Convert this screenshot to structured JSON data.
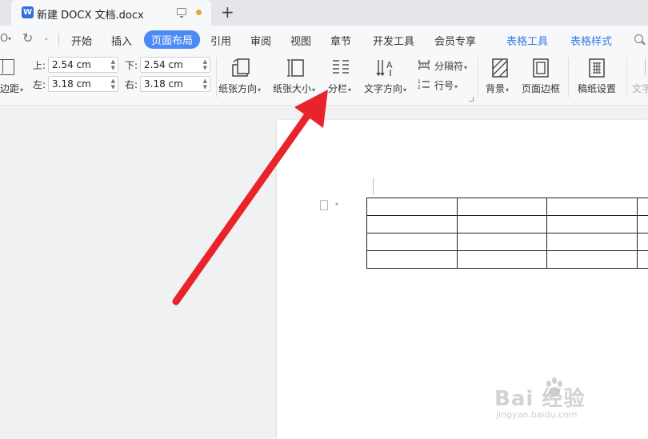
{
  "tab": {
    "doc_icon": "W",
    "title": "新建 DOCX 文档.docx"
  },
  "menu": {
    "glyph_left": "O",
    "items": [
      "开始",
      "插入",
      "页面布局",
      "引用",
      "审阅",
      "视图",
      "章节",
      "开发工具",
      "会员专享",
      "表格工具",
      "表格样式"
    ],
    "active": "页面布局"
  },
  "ribbon": {
    "margins_label": "边距",
    "top_label": "上:",
    "top_value": "2.54 cm",
    "bottom_label": "下:",
    "bottom_value": "2.54 cm",
    "left_label": "左:",
    "left_value": "3.18 cm",
    "right_label": "右:",
    "right_value": "3.18 cm",
    "orientation": "纸张方向",
    "size": "纸张大小",
    "columns": "分栏",
    "text_direction": "文字方向",
    "breaks": "分隔符",
    "line_numbers": "行号",
    "background": "背景",
    "page_border": "页面边框",
    "draft_settings": "稿纸设置",
    "text_cut": "文字"
  },
  "table": {
    "rows": 4,
    "columns": 4
  },
  "watermark": {
    "main": "Bai  经验",
    "sub": "jingyan.baidu.com"
  },
  "colors": {
    "accent": "#4c8bf5",
    "arrow": "#e8232a",
    "tool_tab": "#3b79e0"
  }
}
